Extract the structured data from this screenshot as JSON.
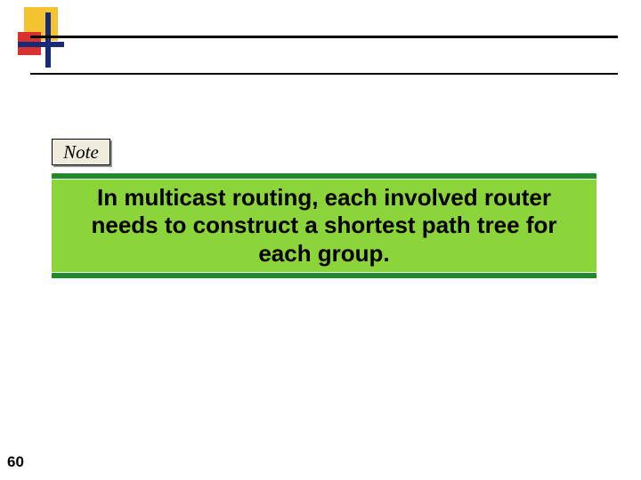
{
  "note": {
    "label": "Note"
  },
  "content": {
    "text": "In multicast routing, each involved router needs to construct a shortest path tree for each group."
  },
  "page": {
    "number": "60"
  }
}
